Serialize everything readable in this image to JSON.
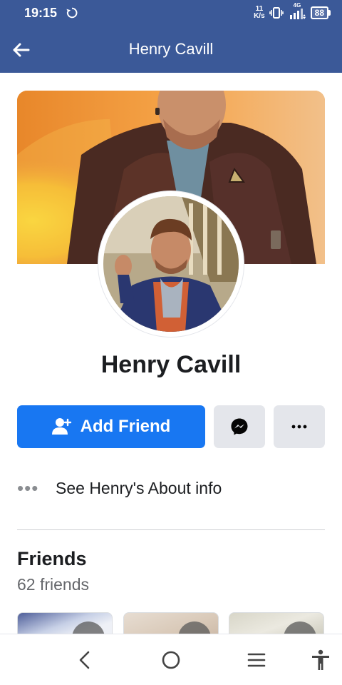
{
  "status_bar": {
    "time": "19:15",
    "net_speed_value": "11",
    "net_speed_unit": "K/s",
    "network_type": "4G",
    "battery": "88"
  },
  "header": {
    "title": "Henry Cavill"
  },
  "profile": {
    "name": "Henry Cavill",
    "add_friend_label": "Add Friend",
    "about_label": "See Henry's About info",
    "about_dots": "•••"
  },
  "friends": {
    "title": "Friends",
    "count_label": "62 friends"
  },
  "colors": {
    "brand": "#3b5998",
    "primary_button": "#1877f2",
    "secondary_button": "#e4e6eb"
  },
  "icons": {
    "back": "arrow-left-icon",
    "messenger": "messenger-icon",
    "more": "more-horizontal-icon",
    "add_friend": "person-add-icon",
    "nav_back": "chevron-left-icon",
    "nav_home": "circle-home-icon",
    "nav_menu": "menu-lines-icon",
    "nav_accessibility": "accessibility-icon"
  }
}
